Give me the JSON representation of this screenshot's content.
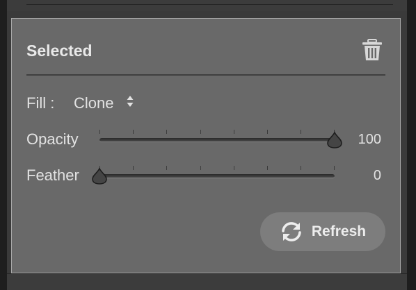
{
  "panel": {
    "title": "Selected",
    "trash_icon": "trash-icon"
  },
  "fill": {
    "label": "Fill :",
    "value": "Clone",
    "icon": "up-down-arrows-icon"
  },
  "opacity": {
    "label": "Opacity",
    "value": "100",
    "level": 1.0
  },
  "feather": {
    "label": "Feather",
    "value": "0",
    "level": 0.0
  },
  "refresh": {
    "label": "Refresh",
    "icon": "refresh-icon"
  },
  "colors": {
    "panel_bg": "#696969",
    "panel_border": "#a9a9a9",
    "button_bg": "#7d7d7d",
    "text": "#e4e4e4"
  }
}
